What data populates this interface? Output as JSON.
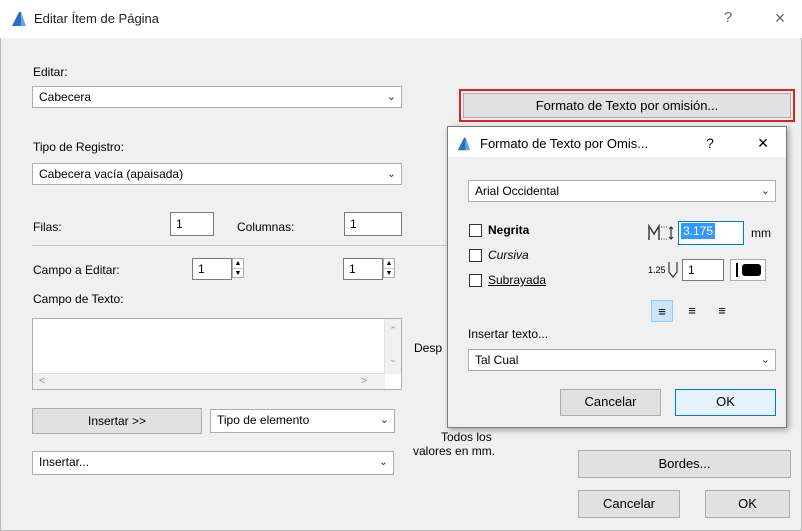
{
  "window": {
    "title": "Editar Ítem de Página",
    "help_label": "?",
    "close_label": "×"
  },
  "editar": {
    "label": "Editar:",
    "value": "Cabecera"
  },
  "formato_button": {
    "label": "Formato de Texto por omisión..."
  },
  "tipo_registro": {
    "label": "Tipo de Registro:",
    "value": "Cabecera vacía (apaisada)"
  },
  "filas": {
    "label": "Filas:",
    "value": "1"
  },
  "columnas": {
    "label": "Columnas:",
    "value": "1"
  },
  "campo_editar": {
    "label": "Campo a Editar:",
    "value1": "1",
    "value2": "1"
  },
  "campo_texto": {
    "label": "Campo de Texto:",
    "value": ""
  },
  "insertar_button": {
    "label": "Insertar >>"
  },
  "tipo_elemento": {
    "value": "Tipo de elemento"
  },
  "insertar_combo": {
    "value": "Insertar..."
  },
  "partial_labels": {
    "desp": "Desp",
    "todos": "Todos los",
    "valores": "valores en mm."
  },
  "bordes_button": {
    "label": "Bordes..."
  },
  "main_cancel": {
    "label": "Cancelar"
  },
  "main_ok": {
    "label": "OK"
  },
  "subdialog": {
    "title": "Formato de Texto por Omis...",
    "help_label": "?",
    "close_label": "×",
    "font": "Arial Occidental",
    "bold": "Negrita",
    "italic": "Cursiva",
    "underline": "Subrayada",
    "size_value": "3.175",
    "size_unit": "mm",
    "spacing_label": "1.25",
    "pen_value": "1",
    "insert_text_label": "Insertar texto...",
    "insert_text_value": "Tal Cual",
    "cancel_label": "Cancelar",
    "ok_label": "OK"
  },
  "colors": {
    "highlight": "#e02020",
    "accent": "#0078d7",
    "selection": "#3399ff"
  }
}
